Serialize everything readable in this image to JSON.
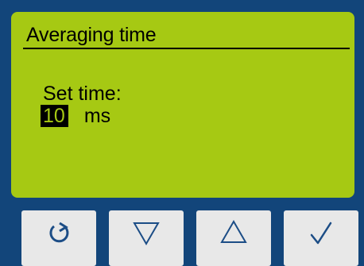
{
  "screen": {
    "title": "Averaging time",
    "set_label": "Set time:",
    "value": "10",
    "unit": "ms"
  },
  "buttons": [
    {
      "name": "back",
      "icon": "rotate-back-icon"
    },
    {
      "name": "down",
      "icon": "triangle-down-icon"
    },
    {
      "name": "up",
      "icon": "triangle-up-icon"
    },
    {
      "name": "confirm",
      "icon": "checkmark-icon"
    }
  ],
  "colors": {
    "bezel": "#12457a",
    "lcd_background": "#a6c913",
    "lcd_text": "#000000",
    "button_face": "#e8e8e8",
    "icon_color": "#1c4d86"
  }
}
